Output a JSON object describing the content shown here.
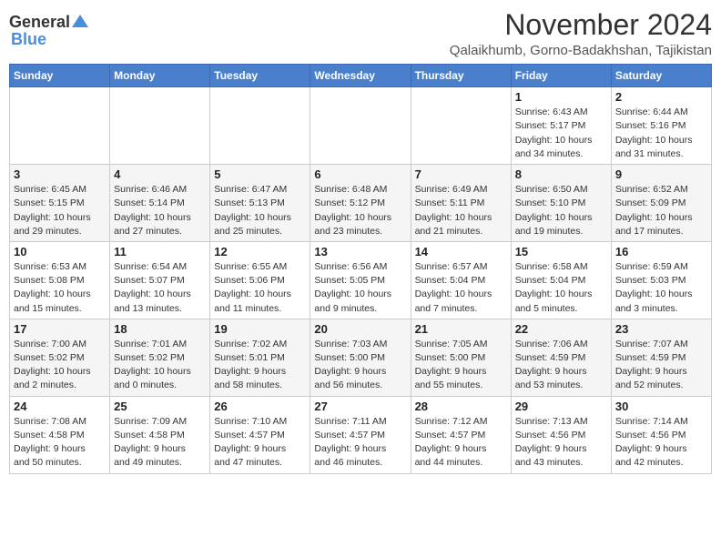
{
  "header": {
    "logo_general": "General",
    "logo_blue": "Blue",
    "month_title": "November 2024",
    "location": "Qalaikhumb, Gorno-Badakhshan, Tajikistan"
  },
  "weekdays": [
    "Sunday",
    "Monday",
    "Tuesday",
    "Wednesday",
    "Thursday",
    "Friday",
    "Saturday"
  ],
  "weeks": [
    [
      {
        "day": "",
        "info": ""
      },
      {
        "day": "",
        "info": ""
      },
      {
        "day": "",
        "info": ""
      },
      {
        "day": "",
        "info": ""
      },
      {
        "day": "",
        "info": ""
      },
      {
        "day": "1",
        "info": "Sunrise: 6:43 AM\nSunset: 5:17 PM\nDaylight: 10 hours\nand 34 minutes."
      },
      {
        "day": "2",
        "info": "Sunrise: 6:44 AM\nSunset: 5:16 PM\nDaylight: 10 hours\nand 31 minutes."
      }
    ],
    [
      {
        "day": "3",
        "info": "Sunrise: 6:45 AM\nSunset: 5:15 PM\nDaylight: 10 hours\nand 29 minutes."
      },
      {
        "day": "4",
        "info": "Sunrise: 6:46 AM\nSunset: 5:14 PM\nDaylight: 10 hours\nand 27 minutes."
      },
      {
        "day": "5",
        "info": "Sunrise: 6:47 AM\nSunset: 5:13 PM\nDaylight: 10 hours\nand 25 minutes."
      },
      {
        "day": "6",
        "info": "Sunrise: 6:48 AM\nSunset: 5:12 PM\nDaylight: 10 hours\nand 23 minutes."
      },
      {
        "day": "7",
        "info": "Sunrise: 6:49 AM\nSunset: 5:11 PM\nDaylight: 10 hours\nand 21 minutes."
      },
      {
        "day": "8",
        "info": "Sunrise: 6:50 AM\nSunset: 5:10 PM\nDaylight: 10 hours\nand 19 minutes."
      },
      {
        "day": "9",
        "info": "Sunrise: 6:52 AM\nSunset: 5:09 PM\nDaylight: 10 hours\nand 17 minutes."
      }
    ],
    [
      {
        "day": "10",
        "info": "Sunrise: 6:53 AM\nSunset: 5:08 PM\nDaylight: 10 hours\nand 15 minutes."
      },
      {
        "day": "11",
        "info": "Sunrise: 6:54 AM\nSunset: 5:07 PM\nDaylight: 10 hours\nand 13 minutes."
      },
      {
        "day": "12",
        "info": "Sunrise: 6:55 AM\nSunset: 5:06 PM\nDaylight: 10 hours\nand 11 minutes."
      },
      {
        "day": "13",
        "info": "Sunrise: 6:56 AM\nSunset: 5:05 PM\nDaylight: 10 hours\nand 9 minutes."
      },
      {
        "day": "14",
        "info": "Sunrise: 6:57 AM\nSunset: 5:04 PM\nDaylight: 10 hours\nand 7 minutes."
      },
      {
        "day": "15",
        "info": "Sunrise: 6:58 AM\nSunset: 5:04 PM\nDaylight: 10 hours\nand 5 minutes."
      },
      {
        "day": "16",
        "info": "Sunrise: 6:59 AM\nSunset: 5:03 PM\nDaylight: 10 hours\nand 3 minutes."
      }
    ],
    [
      {
        "day": "17",
        "info": "Sunrise: 7:00 AM\nSunset: 5:02 PM\nDaylight: 10 hours\nand 2 minutes."
      },
      {
        "day": "18",
        "info": "Sunrise: 7:01 AM\nSunset: 5:02 PM\nDaylight: 10 hours\nand 0 minutes."
      },
      {
        "day": "19",
        "info": "Sunrise: 7:02 AM\nSunset: 5:01 PM\nDaylight: 9 hours\nand 58 minutes."
      },
      {
        "day": "20",
        "info": "Sunrise: 7:03 AM\nSunset: 5:00 PM\nDaylight: 9 hours\nand 56 minutes."
      },
      {
        "day": "21",
        "info": "Sunrise: 7:05 AM\nSunset: 5:00 PM\nDaylight: 9 hours\nand 55 minutes."
      },
      {
        "day": "22",
        "info": "Sunrise: 7:06 AM\nSunset: 4:59 PM\nDaylight: 9 hours\nand 53 minutes."
      },
      {
        "day": "23",
        "info": "Sunrise: 7:07 AM\nSunset: 4:59 PM\nDaylight: 9 hours\nand 52 minutes."
      }
    ],
    [
      {
        "day": "24",
        "info": "Sunrise: 7:08 AM\nSunset: 4:58 PM\nDaylight: 9 hours\nand 50 minutes."
      },
      {
        "day": "25",
        "info": "Sunrise: 7:09 AM\nSunset: 4:58 PM\nDaylight: 9 hours\nand 49 minutes."
      },
      {
        "day": "26",
        "info": "Sunrise: 7:10 AM\nSunset: 4:57 PM\nDaylight: 9 hours\nand 47 minutes."
      },
      {
        "day": "27",
        "info": "Sunrise: 7:11 AM\nSunset: 4:57 PM\nDaylight: 9 hours\nand 46 minutes."
      },
      {
        "day": "28",
        "info": "Sunrise: 7:12 AM\nSunset: 4:57 PM\nDaylight: 9 hours\nand 44 minutes."
      },
      {
        "day": "29",
        "info": "Sunrise: 7:13 AM\nSunset: 4:56 PM\nDaylight: 9 hours\nand 43 minutes."
      },
      {
        "day": "30",
        "info": "Sunrise: 7:14 AM\nSunset: 4:56 PM\nDaylight: 9 hours\nand 42 minutes."
      }
    ]
  ]
}
